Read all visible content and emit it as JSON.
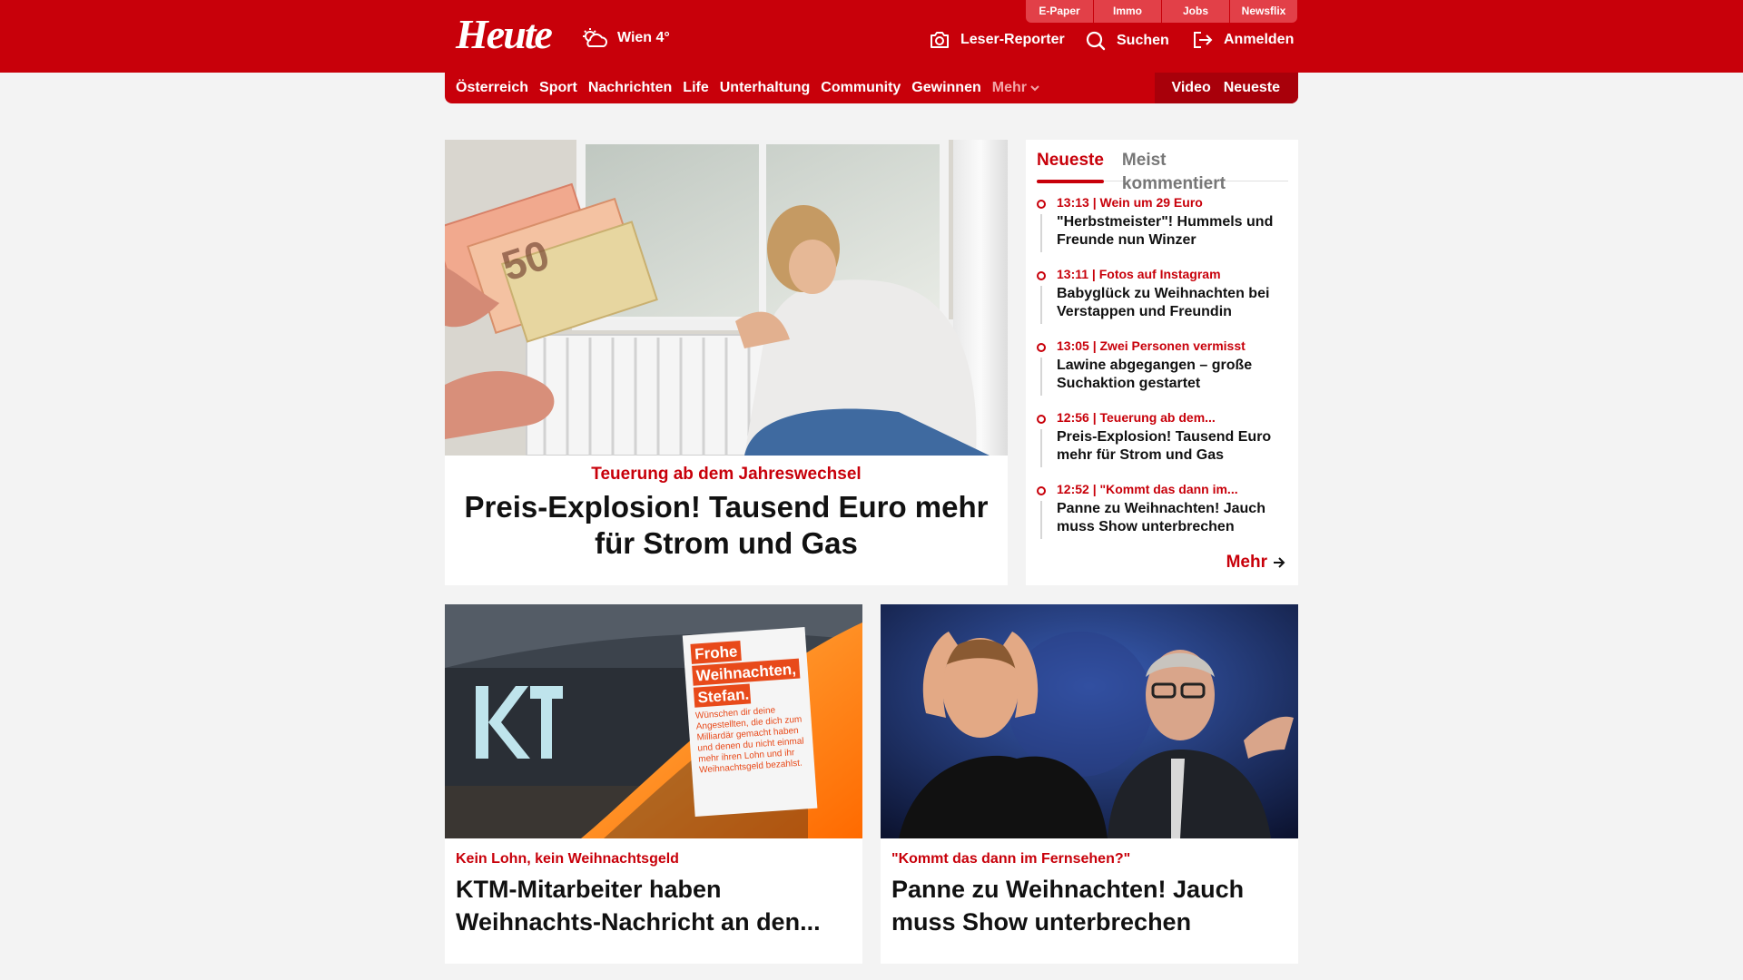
{
  "brand": {
    "logo": "Heute",
    "accent": "#c8000a"
  },
  "weather": {
    "city_temp": "Wien 4°"
  },
  "utility_links": [
    "E-Paper",
    "Immo",
    "Jobs",
    "Newsflix"
  ],
  "header_actions": {
    "reporter": "Leser-Reporter",
    "search": "Suchen",
    "login": "Anmelden"
  },
  "nav": {
    "items": [
      "Österreich",
      "Sport",
      "Nachrichten",
      "Life",
      "Unterhaltung",
      "Community",
      "Gewinnen"
    ],
    "more": "Mehr",
    "right": [
      "Video",
      "Neueste"
    ]
  },
  "hero": {
    "kicker": "Teuerung ab dem Jahreswechsel",
    "title": "Preis-Explosion! Tausend Euro mehr für Strom und Gas"
  },
  "sidebar": {
    "tabs": [
      "Neueste",
      "Meist kommentiert"
    ],
    "feed": [
      {
        "meta": "13:13 | Wein um 29 Euro",
        "title": "\"Herbstmeister\"! Hummels und Freunde nun Winzer"
      },
      {
        "meta": "13:11 | Fotos auf Instagram",
        "title": "Babyglück zu Weihnachten bei Verstappen und Freundin"
      },
      {
        "meta": "13:05 | Zwei Personen vermisst",
        "title": "Lawine abgegangen – große Suchaktion gestartet"
      },
      {
        "meta": "12:56 | Teuerung ab dem...",
        "title": "Preis-Explosion! Tausend Euro mehr für Strom und Gas"
      },
      {
        "meta": "12:52 | \"Kommt das dann im...",
        "title": "Panne zu Weihnachten! Jauch muss Show unterbrechen"
      }
    ],
    "more": "Mehr"
  },
  "cards": [
    {
      "kicker": "Kein Lohn, kein Weihnachtsgeld",
      "title": "KTM-Mitarbeiter haben Weihnachts-Nachricht an den...",
      "sign_text": [
        "Frohe",
        "Weihnachten,",
        "Stefan.",
        "Wünschen dir deine Angestellten, die dich zum Milliardär gemacht haben und denen du nicht einmal mehr ihren Lohn und ihr Weihnachtsgeld bezahlst."
      ]
    },
    {
      "kicker": "\"Kommt das dann im Fernsehen?\"",
      "title": "Panne zu Weihnachten! Jauch muss Show unterbrechen"
    }
  ]
}
